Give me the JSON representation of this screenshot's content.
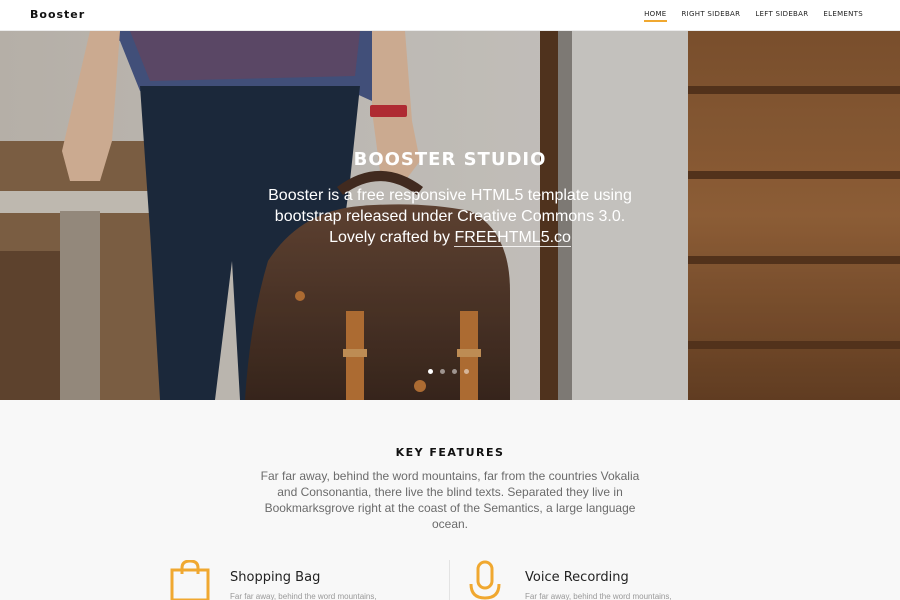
{
  "nav": {
    "brand": "Booster",
    "items": [
      {
        "label": "Home",
        "active": true
      },
      {
        "label": "Right Sidebar",
        "active": false
      },
      {
        "label": "Left Sidebar",
        "active": false
      },
      {
        "label": "Elements",
        "active": false
      }
    ]
  },
  "hero": {
    "title": "BOOSTER STUDIO",
    "subtitle_prefix": "Booster is a free responsive HTML5 template using bootstrap released under Creative Commons 3.0. Lovely crafted by ",
    "link_text": "FREEHTML5.co",
    "slides": 4,
    "active_slide": 1
  },
  "features": {
    "heading": "KEY FEATURES",
    "text": "Far far away, behind the word mountains, far from the countries Vokalia and Consonantia, there live the blind texts. Separated they live in Bookmarksgrove right at the coast of the Semantics, a large language ocean.",
    "items": [
      {
        "icon": "shopping-bag-icon",
        "title": "Shopping Bag",
        "desc": "Far far away, behind the word mountains,"
      },
      {
        "icon": "microphone-icon",
        "title": "Voice Recording",
        "desc": "Far far away, behind the word mountains,"
      }
    ]
  },
  "colors": {
    "accent": "#f0a830",
    "nav_bg": "#ffffff",
    "features_bg": "#f8f8f8"
  }
}
